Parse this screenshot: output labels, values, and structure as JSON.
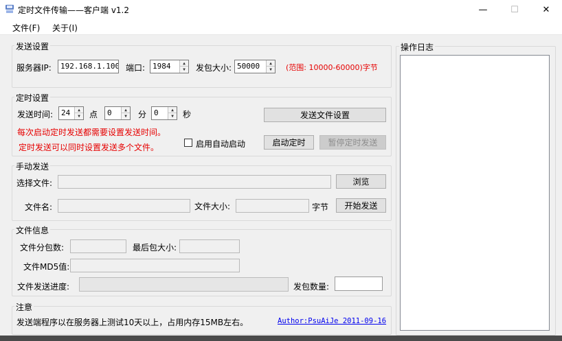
{
  "window": {
    "title": "定时文件传输——客户端 v1.2",
    "minimize": "—",
    "maximize": "☐",
    "close": "✕"
  },
  "menu": {
    "file": "文件(F)",
    "about": "关于(I)"
  },
  "send_settings": {
    "title": "发送设置",
    "server_ip_label": "服务器IP:",
    "server_ip_value": "192.168.1.100",
    "port_label": "端口:",
    "port_value": "1984",
    "packet_size_label": "发包大小:",
    "packet_size_value": "50000",
    "range_hint": "(范围: 10000-60000)字节"
  },
  "timer_settings": {
    "title": "定时设置",
    "send_time_label": "发送时间:",
    "hour_value": "24",
    "hour_unit": "点",
    "minute_value": "0",
    "minute_unit": "分",
    "second_value": "0",
    "second_unit": "秒",
    "send_file_settings_button": "发送文件设置",
    "note_line1": "每次启动定时发送都需要设置发送时间。",
    "note_line2": "定时发送可以同时设置发送多个文件。",
    "auto_start_label": "启用自动启动",
    "start_timer_button": "启动定时",
    "pause_timer_button": "暂停定时发送"
  },
  "manual_send": {
    "title": "手动发送",
    "select_file_label": "选择文件:",
    "browse_button": "浏览",
    "file_name_label": "文件名:",
    "file_size_label": "文件大小:",
    "bytes_unit": "字节",
    "start_send_button": "开始发送"
  },
  "file_info": {
    "title": "文件信息",
    "packet_count_label": "文件分包数:",
    "last_packet_label": "最后包大小:",
    "md5_label": "文件MD5值:",
    "progress_label": "文件发送进度:",
    "sent_count_label": "发包数量:"
  },
  "notice": {
    "title": "注意",
    "text": "发送端程序以在服务器上测试10天以上，占用内存15MB左右。",
    "author": "Author:PsuAiJe 2011-09-16"
  },
  "log": {
    "title": "操作日志"
  },
  "colors": {
    "warning": "#e60000",
    "link": "#0000ee"
  }
}
